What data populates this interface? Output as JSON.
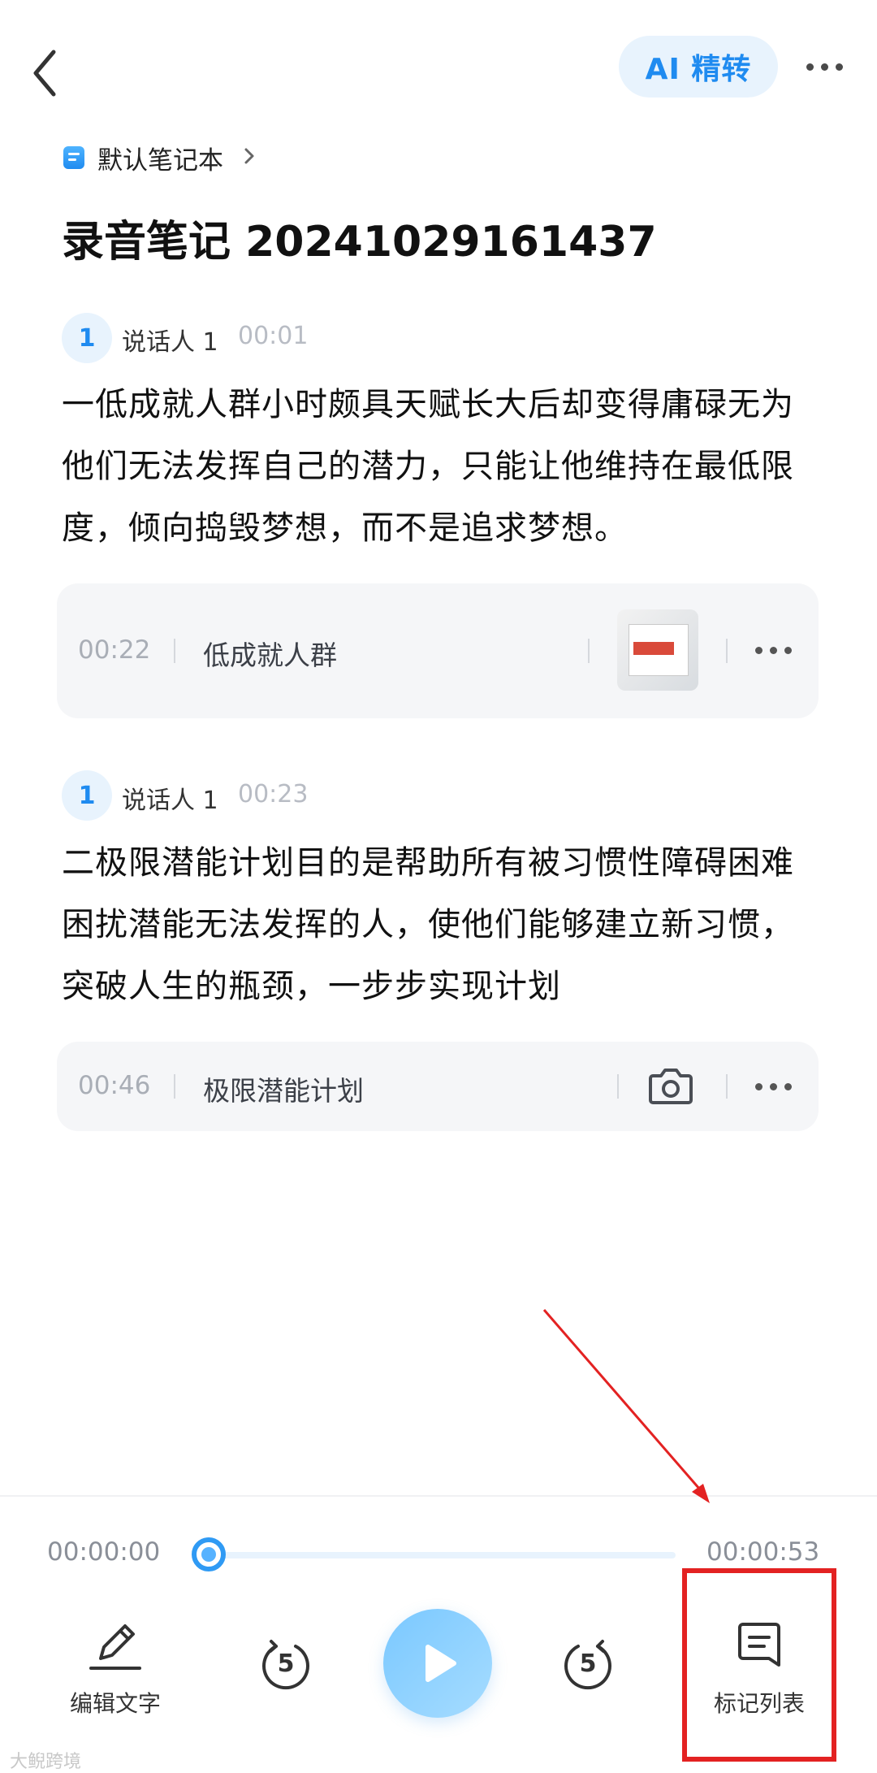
{
  "header": {
    "ai_button_label": "AI 精转"
  },
  "notebook": {
    "name": "默认笔记本"
  },
  "note": {
    "title": "录音笔记 20241029161437"
  },
  "segments": [
    {
      "speaker_badge": "1",
      "speaker_name": "说话人 1",
      "timestamp": "00:01",
      "text": "一低成就人群小时颇具天赋长大后却变得庸碌无为他们无法发挥自己的潜力，只能让他维持在最低限度，倾向捣毁梦想，而不是追求梦想。",
      "marker": {
        "time": "00:22",
        "label": "低成就人群",
        "attachment": "image-thumbnail"
      }
    },
    {
      "speaker_badge": "1",
      "speaker_name": "说话人 1",
      "timestamp": "00:23",
      "text": "二极限潜能计划目的是帮助所有被习惯性障碍困难困扰潜能无法发挥的人，使他们能够建立新习惯，突破人生的瓶颈，一步步实现计划",
      "marker": {
        "time": "00:46",
        "label": "极限潜能计划",
        "attachment": "camera-icon"
      }
    }
  ],
  "player": {
    "current_time": "00:00:00",
    "total_time": "00:00:53",
    "progress": 0,
    "accent_color": "#2f9af4",
    "edit_label": "编辑文字",
    "rewind_label": "5",
    "forward_label": "5",
    "marker_list_label": "标记列表"
  },
  "annotation": {
    "color": "#e32222"
  },
  "watermark": "大鲵跨境"
}
